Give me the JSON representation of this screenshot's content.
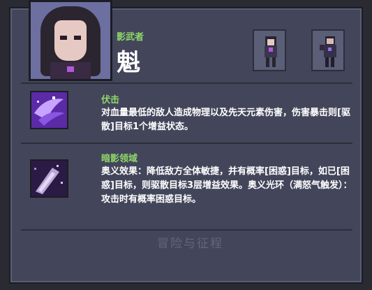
{
  "character": {
    "class_label": "影武者",
    "name": "魁"
  },
  "skills": [
    {
      "name": "伏击",
      "description": "对血量最低的敌人造成物理以及先天元素伤害，伤害暴击则[驱散]目标1个增益状态。"
    },
    {
      "name": "暗影领域",
      "description": "奥义效果：降低敌方全体敏捷，并有概率[困惑]目标，如已[困惑]目标，则驱散目标3层增益效果。奥义光环（满怒气触发）：攻击时有概率困惑目标。"
    }
  ],
  "watermark": "冒险与征程",
  "colors": {
    "panel_bg": "#43465a",
    "accent_green": "#8fd86a",
    "text_white": "#ffffff",
    "skill_icon_purple": "#7a3fd0"
  }
}
